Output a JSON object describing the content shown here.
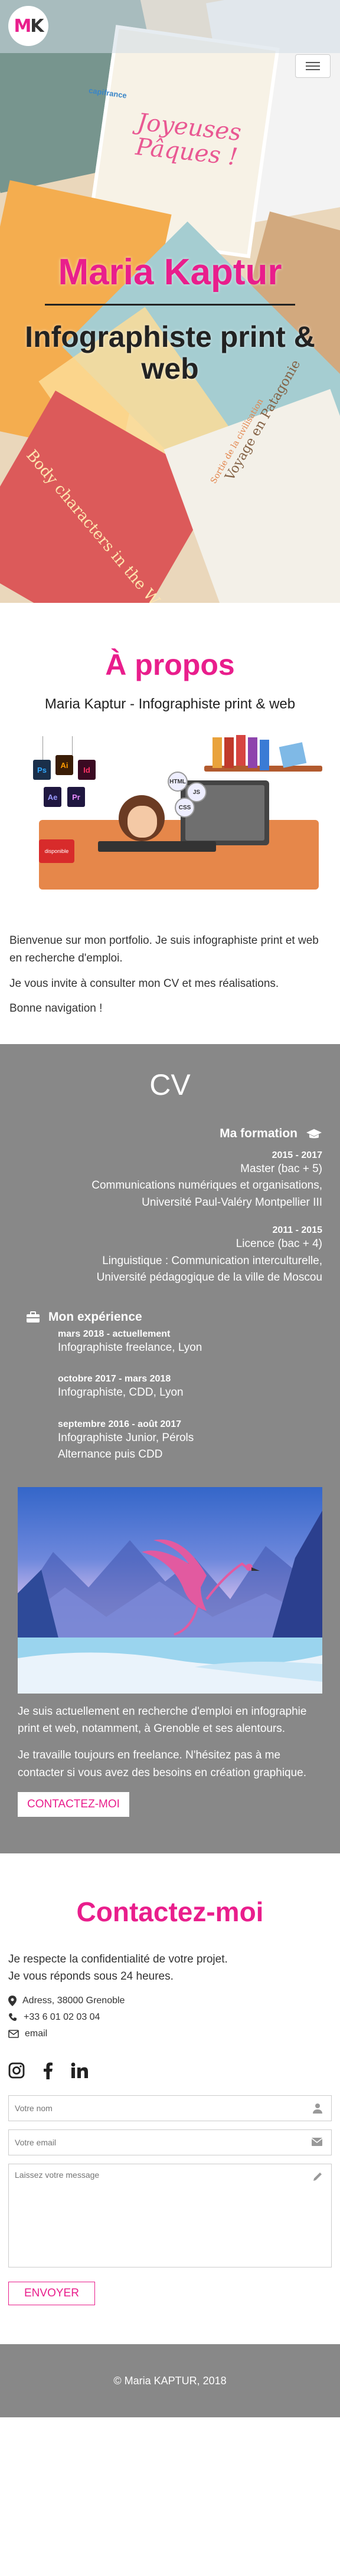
{
  "nav": {
    "logo_text_m": "M",
    "logo_text_k": "K",
    "menu_icon": "hamburger-icon"
  },
  "hero": {
    "title": "Maria Kaptur",
    "subtitle": "Infographiste print & web",
    "decor": {
      "easter_line1": "Joyeuses",
      "easter_line2": "Pâques !",
      "brand": "capifrance",
      "deco1": "Voyage en Patagonie",
      "deco2": "Body characters in the W",
      "deco3": "Sortie de la civilisation"
    }
  },
  "about": {
    "title": "À propos",
    "subtitle": "Maria Kaptur - Infographiste print & web",
    "illustration": {
      "app_icons": [
        "Ps",
        "Ai",
        "Id",
        "Ae",
        "Pr"
      ],
      "bubbles": [
        "HTML",
        "JS",
        "CSS"
      ],
      "card": "disponible"
    },
    "paragraphs": [
      "Bienvenue sur mon portfolio. Je suis infographiste print et web en recherche d'emploi.",
      "Je vous invite à consulter mon CV et mes réalisations.",
      "Bonne navigation !"
    ]
  },
  "cv": {
    "title": "CV",
    "formation": {
      "heading": "Ma formation",
      "icon": "graduation-cap-icon",
      "items": [
        {
          "dates": "2015 - 2017",
          "lines": [
            "Master (bac + 5)",
            "Communications numériques et organisations,",
            "Université Paul-Valéry Montpellier III"
          ]
        },
        {
          "dates": "2011 - 2015",
          "lines": [
            "Licence (bac + 4)",
            "Linguistique : Communication interculturelle,",
            "Université pédagogique de la ville de Moscou"
          ]
        }
      ]
    },
    "experience": {
      "heading": "Mon expérience",
      "icon": "briefcase-icon",
      "items": [
        {
          "dates": "mars 2018 - actuellement",
          "lines": [
            "Infographiste freelance, Lyon"
          ]
        },
        {
          "dates": "octobre 2017 - mars 2018",
          "lines": [
            "Infographiste, CDD, Lyon"
          ]
        },
        {
          "dates": "septembre 2016 - août 2017",
          "lines": [
            "Infographiste Junior, Pérols",
            "Alternance puis CDD"
          ]
        }
      ]
    },
    "paragraphs": [
      "Je suis actuellement en recherche d'emploi en infographie print et web, notamment, à Grenoble et ses alentours.",
      "Je travaille toujours en freelance. N'hésitez pas à me contacter si vous avez des besoins en création graphique."
    ],
    "cta": "CONTACTEZ-MOI"
  },
  "contact": {
    "title": "Contactez-moi",
    "lead_1": "Je respecte la confidentialité de votre projet.",
    "lead_2": "Je vous réponds sous 24 heures.",
    "address": "Adress, 38000 Grenoble",
    "phone": "+33 6 01 02 03 04",
    "email": "email",
    "socials": [
      "instagram-icon",
      "facebook-icon",
      "linkedin-icon"
    ],
    "form": {
      "name_placeholder": "Votre nom",
      "email_placeholder": "Votre email",
      "message_placeholder": "Laissez votre message",
      "submit": "ENVOYER"
    }
  },
  "footer": {
    "text": "© Maria KAPTUR, 2018"
  },
  "colors": {
    "accent": "#e91e8c",
    "cv_bg": "#888888",
    "text": "#333333"
  }
}
